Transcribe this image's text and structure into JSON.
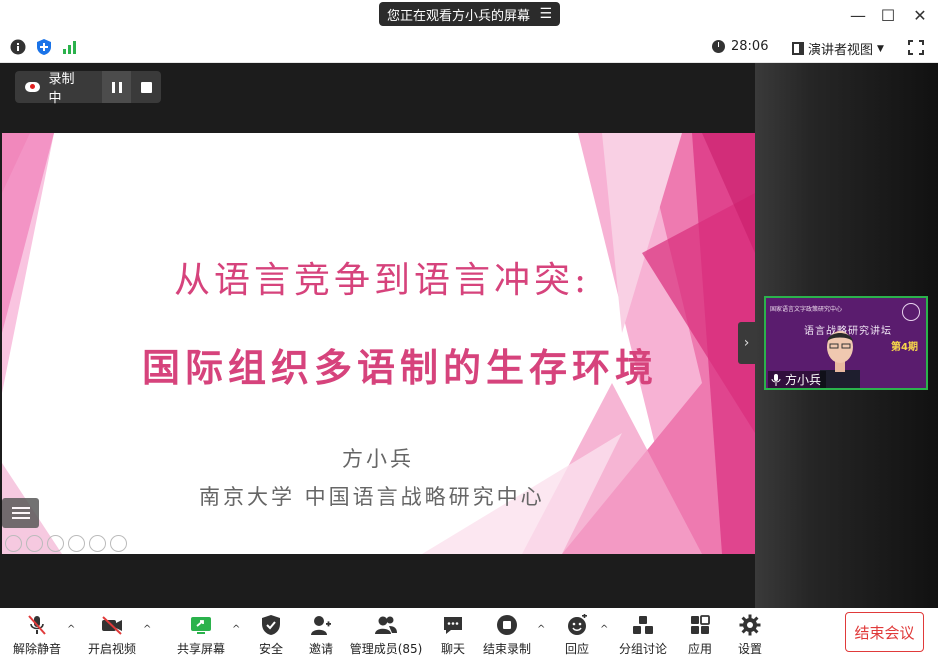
{
  "titlebar": {
    "share_banner": "您正在观看方小兵的屏幕",
    "menu_glyph": "☰",
    "minimize": "—",
    "maximize": "☐",
    "close": "✕"
  },
  "infobar": {
    "timer": "28:06",
    "view_mode": "演讲者视图",
    "signal_color": "#2bb24c",
    "shield_color": "#1a73e8"
  },
  "recording": {
    "status": "录制中"
  },
  "slide": {
    "title_line1": "从语言竞争到语言冲突:",
    "title_line2": "国际组织多语制的生存环境",
    "author": "方小兵",
    "affiliation": "南京大学  中国语言战略研究中心",
    "accent_color": "#d6437c"
  },
  "participant": {
    "name": "方小兵",
    "banner_text": "语言战略研究讲坛",
    "header_text": "国家语言文字政策研究中心",
    "issue": "第4期"
  },
  "toolbar": {
    "items": [
      {
        "label": "解除静音",
        "icon": "mic-muted-icon"
      },
      {
        "label": "开启视频",
        "icon": "video-off-icon"
      },
      {
        "label": "共享屏幕",
        "icon": "share-screen-icon"
      },
      {
        "label": "安全",
        "icon": "shield-icon"
      },
      {
        "label": "邀请",
        "icon": "invite-icon"
      },
      {
        "label": "管理成员(85)",
        "icon": "participants-icon"
      },
      {
        "label": "聊天",
        "icon": "chat-icon"
      },
      {
        "label": "结束录制",
        "icon": "stop-record-icon"
      },
      {
        "label": "回应",
        "icon": "reaction-icon"
      },
      {
        "label": "分组讨论",
        "icon": "breakout-icon"
      },
      {
        "label": "应用",
        "icon": "apps-icon"
      },
      {
        "label": "设置",
        "icon": "gear-icon"
      }
    ],
    "end_meeting": "结束会议"
  }
}
